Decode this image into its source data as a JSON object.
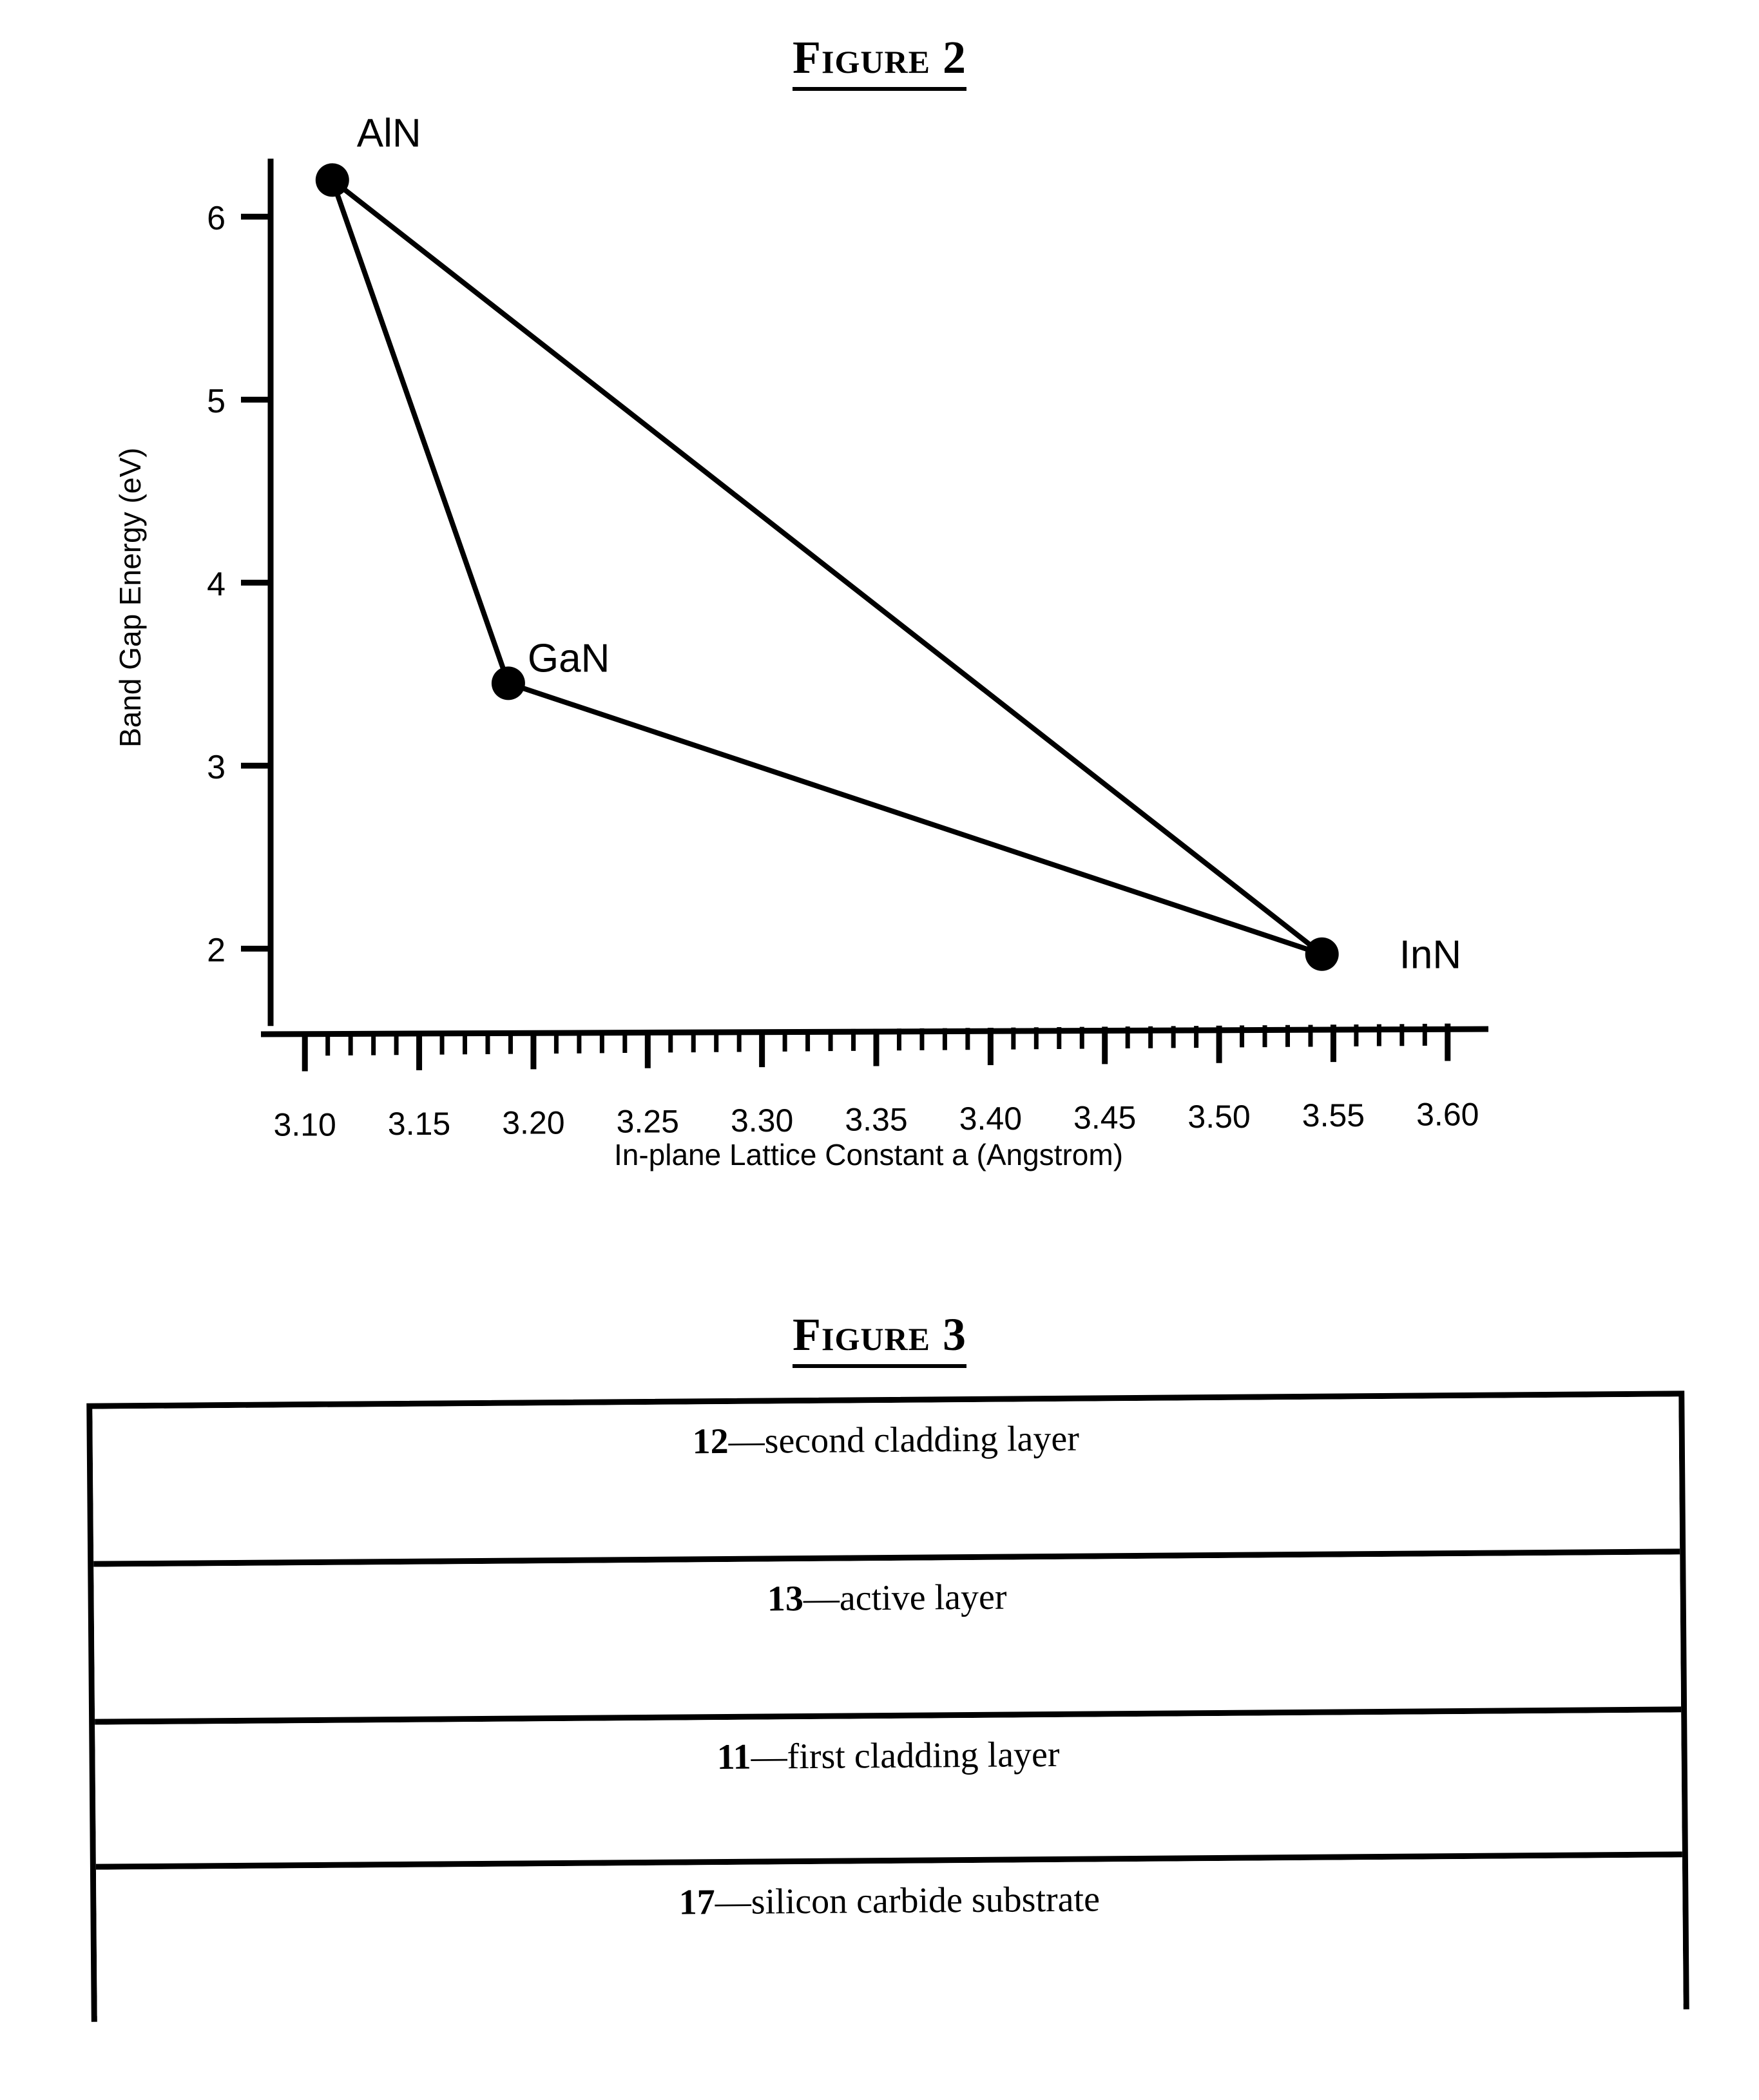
{
  "figure2": {
    "title": "Figure 2",
    "chart_data": {
      "type": "line",
      "title": "Figure 2",
      "xlabel": "In-plane Lattice Constant a (Angstrom)",
      "ylabel": "Band Gap Energy (eV)",
      "xlim": [
        3.085,
        3.615
      ],
      "ylim": [
        1.55,
        6.55
      ],
      "xticks": [
        "3.10",
        "3.15",
        "3.20",
        "3.25",
        "3.30",
        "3.35",
        "3.40",
        "3.45",
        "3.50",
        "3.55",
        "3.60"
      ],
      "xtick_values": [
        3.1,
        3.15,
        3.2,
        3.25,
        3.3,
        3.35,
        3.4,
        3.45,
        3.5,
        3.55,
        3.6
      ],
      "x_minor_step": 0.01,
      "yticks": [
        "2",
        "3",
        "4",
        "5",
        "6"
      ],
      "ytick_values": [
        2,
        3,
        4,
        5,
        6
      ],
      "grid": false,
      "legend": "none",
      "points": [
        {
          "name": "AlN",
          "x": 3.112,
          "y": 6.2,
          "label_dx": 38,
          "label_dy": -52
        },
        {
          "name": "GaN",
          "x": 3.189,
          "y": 3.45,
          "label_dx": 30,
          "label_dy": -18
        },
        {
          "name": "InN",
          "x": 3.545,
          "y": 1.97,
          "label_dx": 120,
          "label_dy": 22
        }
      ],
      "series": [
        {
          "name": "AlN-GaN",
          "from": "AlN",
          "to": "GaN"
        },
        {
          "name": "GaN-InN",
          "from": "GaN",
          "to": "InN"
        },
        {
          "name": "AlN-InN",
          "from": "AlN",
          "to": "InN"
        }
      ],
      "annotations": [
        "AlN",
        "GaN",
        "InN"
      ],
      "marker_color": "#000000",
      "line_color": "#000000"
    }
  },
  "figure3": {
    "title": "Figure 3",
    "layers": [
      {
        "number": "12",
        "dash": "—",
        "name": "second cladding layer"
      },
      {
        "number": "13",
        "dash": "—",
        "name": "active layer"
      },
      {
        "number": "11",
        "dash": "—",
        "name": "first cladding layer"
      },
      {
        "number": "17",
        "dash": "—",
        "name": "silicon carbide substrate"
      }
    ]
  }
}
